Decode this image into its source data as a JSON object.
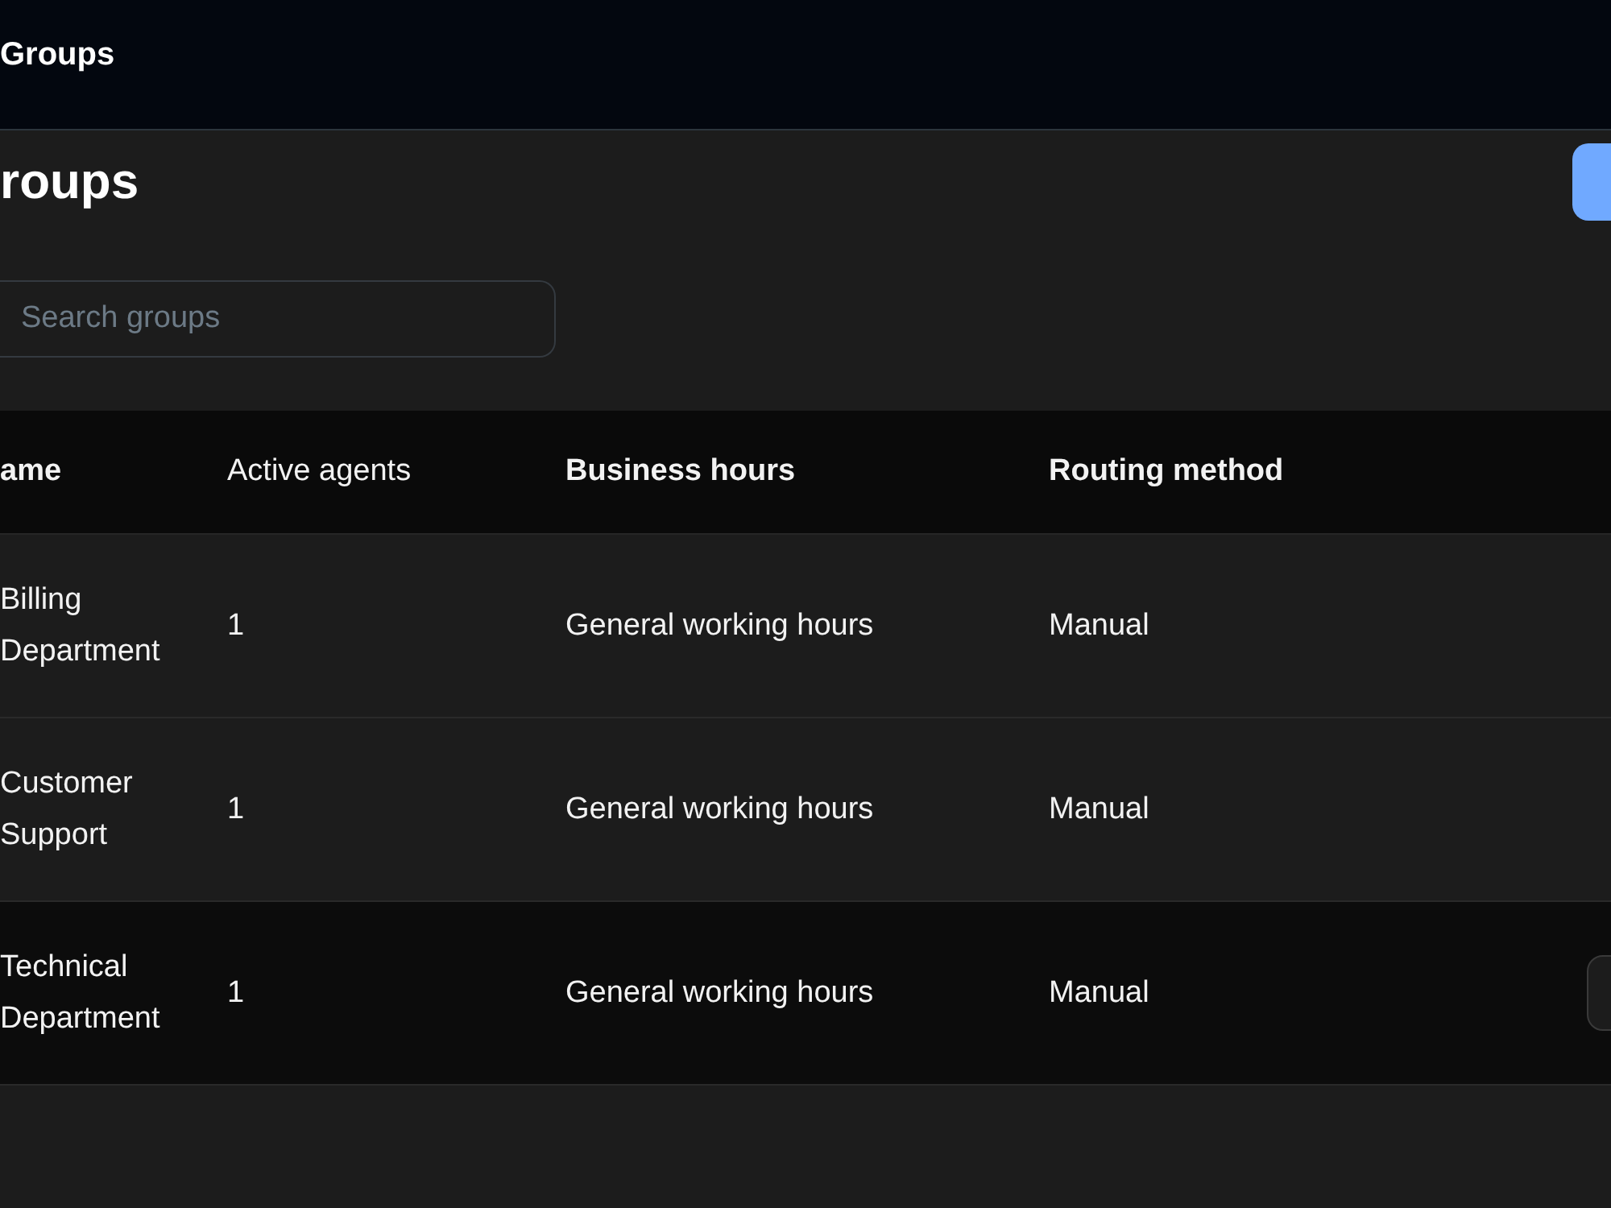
{
  "top_bar": {
    "title": "Groups"
  },
  "heading": "roups",
  "search": {
    "placeholder": "Search groups"
  },
  "table": {
    "columns": [
      {
        "label": "ame",
        "bold": true
      },
      {
        "label": "Active agents",
        "bold": false
      },
      {
        "label": "Business hours",
        "bold": true
      },
      {
        "label": "Routing method",
        "bold": true
      }
    ],
    "rows": [
      {
        "name": "Billing Department",
        "active_agents": "1",
        "business_hours": "General working hours",
        "routing_method": "Manual",
        "highlighted": false
      },
      {
        "name": "Customer Support",
        "active_agents": "1",
        "business_hours": "General working hours",
        "routing_method": "Manual",
        "highlighted": false
      },
      {
        "name": "Technical Department",
        "active_agents": "1",
        "business_hours": "General working hours",
        "routing_method": "Manual",
        "highlighted": true
      }
    ]
  }
}
